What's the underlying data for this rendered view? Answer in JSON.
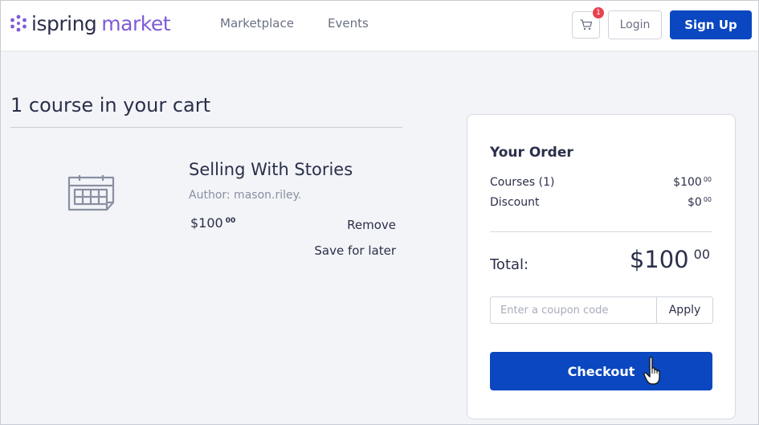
{
  "header": {
    "logo_text_primary": "ispring",
    "logo_text_secondary": "market",
    "nav": [
      {
        "label": "Marketplace"
      },
      {
        "label": "Events"
      }
    ],
    "cart_badge_count": "1",
    "login_label": "Login",
    "signup_label": "Sign Up",
    "icons": {
      "logo": "ispring-star-icon",
      "cart": "shopping-cart-icon"
    }
  },
  "cart": {
    "title": "1 course in your cart",
    "item": {
      "icon": "calendar-icon",
      "title": "Selling With Stories",
      "author": "Author: mason.riley.",
      "price_main": "$100",
      "price_cents": "00",
      "remove_label": "Remove",
      "save_label": "Save for later"
    }
  },
  "order": {
    "title": "Your Order",
    "rows": [
      {
        "label": "Courses (1)",
        "value_main": "$100",
        "value_cents": "00"
      },
      {
        "label": "Discount",
        "value_main": "$0",
        "value_cents": "00"
      }
    ],
    "total_label": "Total:",
    "total_main": "$100",
    "total_cents": "00",
    "coupon_placeholder": "Enter a coupon code",
    "apply_label": "Apply",
    "checkout_label": "Checkout"
  },
  "colors": {
    "brand_purple": "#7e5bd7",
    "primary_blue": "#0a47c0",
    "badge_red": "#e8424f",
    "text_dark": "#2b2f4a",
    "background": "#f2f4f7"
  },
  "cursor": {
    "icon": "hand-pointer-icon"
  }
}
